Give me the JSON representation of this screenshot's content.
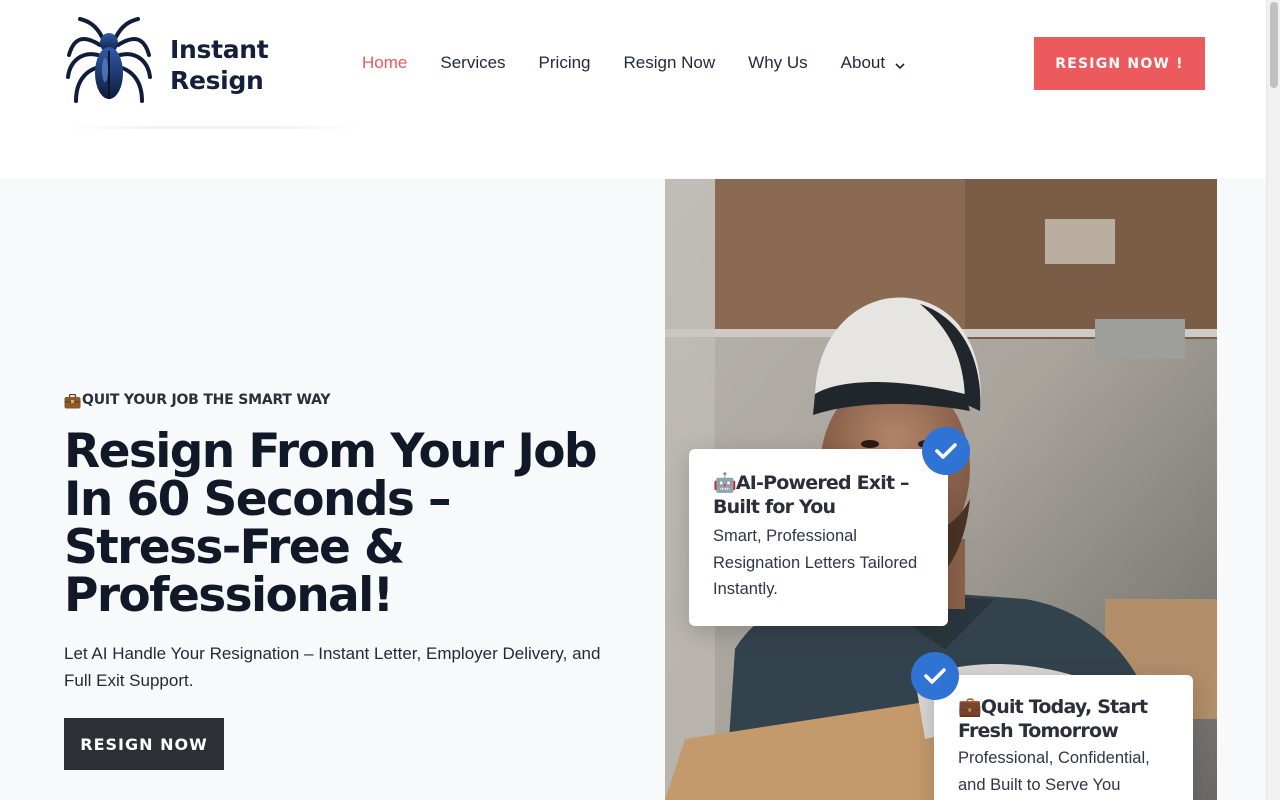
{
  "brand": {
    "line1": "Instant",
    "line2": "Resign",
    "logo_icon": "spider-icon"
  },
  "nav": {
    "items": [
      {
        "label": "Home",
        "active": true
      },
      {
        "label": "Services"
      },
      {
        "label": "Pricing"
      },
      {
        "label": "Resign Now"
      },
      {
        "label": "Why Us"
      },
      {
        "label": "About",
        "dropdown": true
      }
    ],
    "cta": "RESIGN NOW !"
  },
  "hero": {
    "eyebrow": "QUIT YOUR JOB THE SMART WAY",
    "headline": "Resign From Your Job In 60 Seconds – Stress-Free & Professional!",
    "subtext": "Let AI Handle Your Resignation – Instant Letter, Employer Delivery, and Full Exit Support.",
    "cta": "RESIGN NOW"
  },
  "cards": [
    {
      "icon": "🤖",
      "title": "AI-Powered Exit – Built for You",
      "text": "Smart, Professional Resignation Letters Tailored Instantly."
    },
    {
      "icon": "💼",
      "title": "Quit Today, Start Fresh Tomorrow",
      "text": "Professional, Confidential, and Built to Serve You"
    }
  ],
  "colors": {
    "accent": "#ec5a5d",
    "dark": "#2c2f33",
    "check": "#2f73d4",
    "navy": "#14203a"
  }
}
